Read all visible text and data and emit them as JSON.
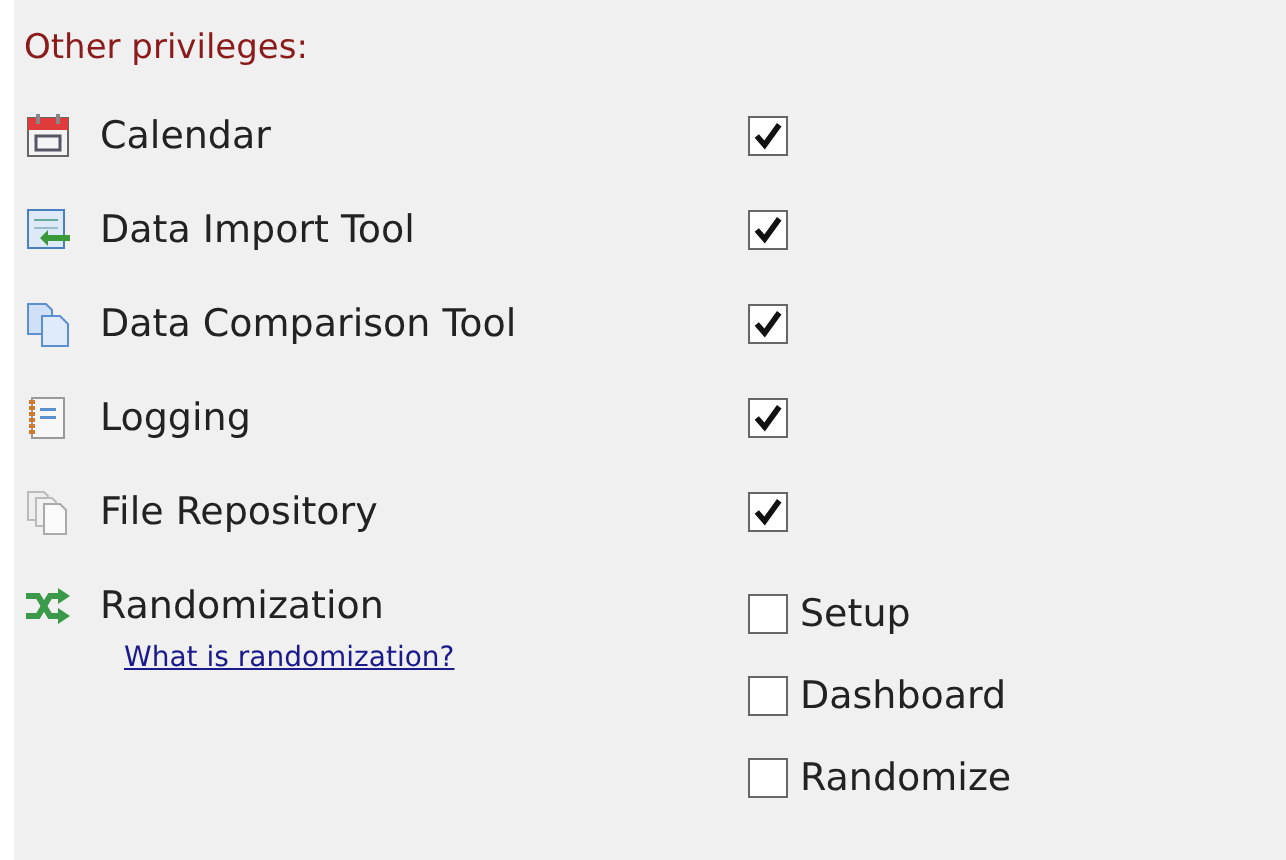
{
  "heading": "Other privileges:",
  "privileges": [
    {
      "label": "Calendar",
      "kind": "check",
      "checked": true
    },
    {
      "label": "Data Import Tool",
      "kind": "check",
      "checked": true
    },
    {
      "label": "Data Comparison Tool",
      "kind": "check",
      "checked": true
    },
    {
      "label": "Logging",
      "kind": "check",
      "checked": true
    },
    {
      "label": "File Repository",
      "kind": "check",
      "checked": true
    },
    {
      "label": "Randomization",
      "kind": "options",
      "link": "What is randomization?",
      "options": [
        {
          "label": "Setup",
          "checked": false
        },
        {
          "label": "Dashboard",
          "checked": false
        },
        {
          "label": "Randomize",
          "checked": false
        }
      ]
    }
  ]
}
